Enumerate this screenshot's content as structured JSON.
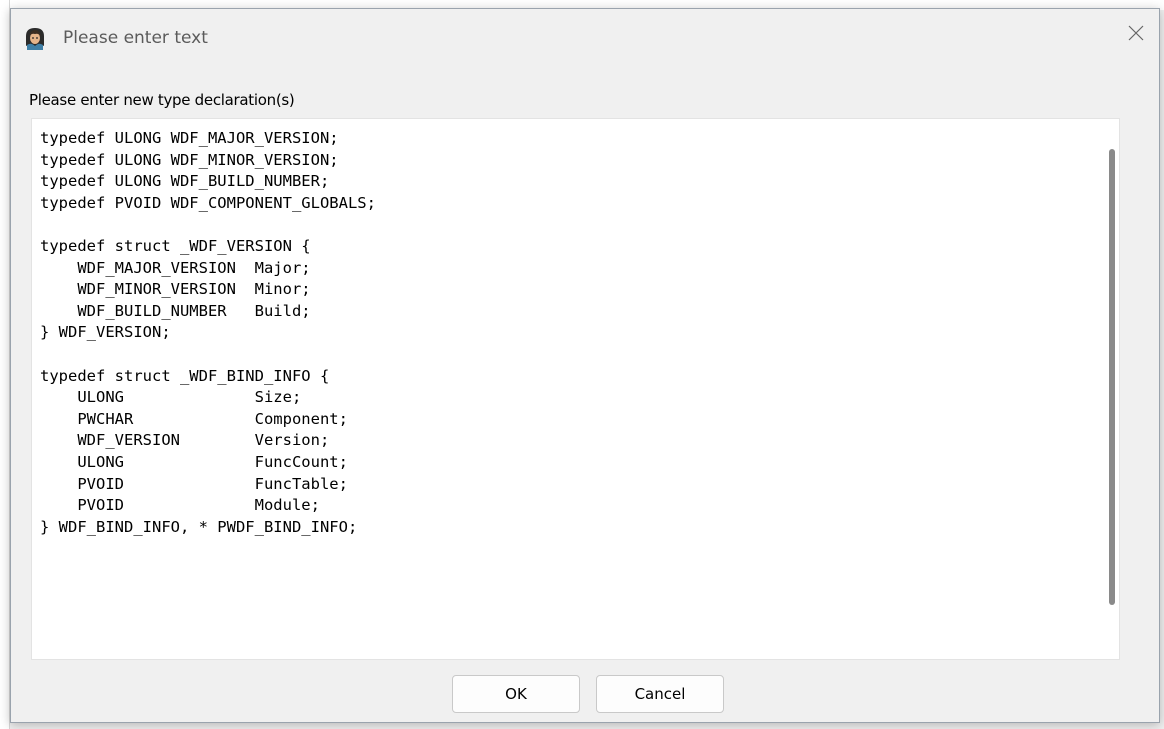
{
  "dialog": {
    "title": "Please enter text",
    "close_glyph": "✕",
    "icon": "app-avatar-icon",
    "prompt": "Please enter new type declaration(s)"
  },
  "editor": {
    "lines": [
      "typedef ULONG WDF_MAJOR_VERSION;",
      "typedef ULONG WDF_MINOR_VERSION;",
      "typedef ULONG WDF_BUILD_NUMBER;",
      "typedef PVOID WDF_COMPONENT_GLOBALS;",
      "",
      "typedef struct _WDF_VERSION {",
      "    WDF_MAJOR_VERSION  Major;",
      "    WDF_MINOR_VERSION  Minor;",
      "    WDF_BUILD_NUMBER   Build;",
      "} WDF_VERSION;",
      "",
      "typedef struct _WDF_BIND_INFO {",
      "    ULONG              Size;",
      "    PWCHAR             Component;",
      "    WDF_VERSION        Version;",
      "    ULONG              FuncCount;",
      "    PVOID              FuncTable;",
      "    PVOID              Module;",
      "} WDF_BIND_INFO, * PWDF_BIND_INFO;"
    ]
  },
  "buttons": {
    "ok_label": "OK",
    "cancel_label": "Cancel"
  },
  "colors": {
    "dialog_bg": "#f0f0f0",
    "editor_bg": "#ffffff",
    "scrollbar": "#8a8a8a"
  }
}
